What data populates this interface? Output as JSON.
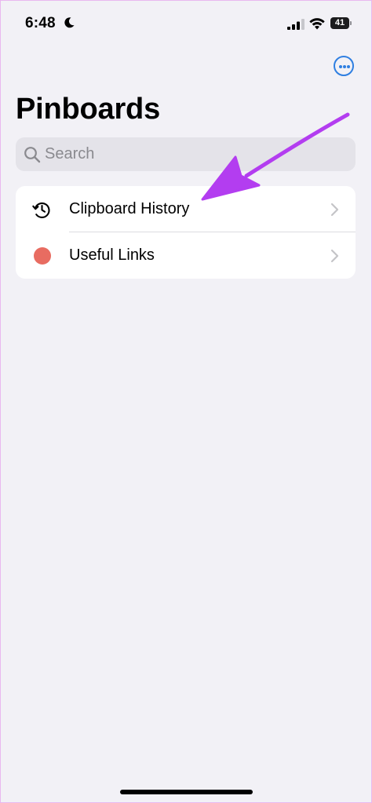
{
  "status_bar": {
    "time": "6:48",
    "battery_level": "41",
    "icons": [
      "moon-icon",
      "cellular-signal-icon",
      "wifi-icon",
      "battery-icon"
    ]
  },
  "header": {
    "more_button_icon": "ellipsis-circle-icon",
    "title": "Pinboards"
  },
  "search": {
    "placeholder": "Search",
    "value": "",
    "icon": "magnifying-glass-icon"
  },
  "list": {
    "items": [
      {
        "label": "Clipboard History",
        "icon": "clock-history-icon"
      },
      {
        "label": "Useful Links",
        "icon": "color-dot",
        "color": "#e86c61"
      }
    ]
  },
  "colors": {
    "accent": "#2f7fe1",
    "background": "#f2f1f6",
    "annotation_arrow": "#b33df0",
    "useful_links_dot": "#e86c61"
  }
}
